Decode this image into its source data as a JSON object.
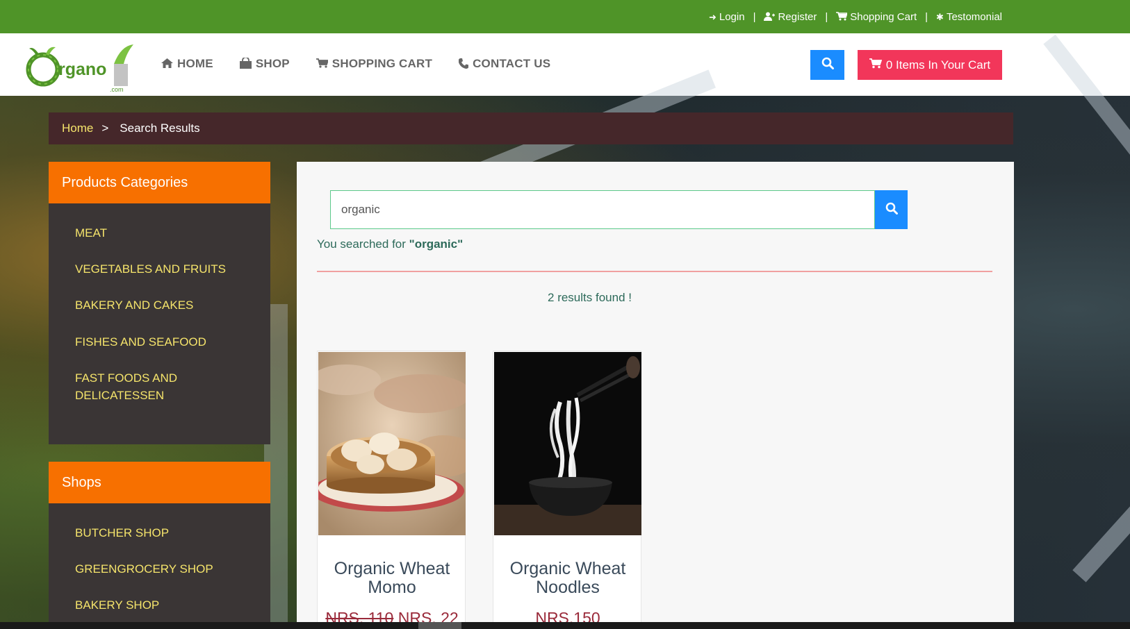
{
  "topbar": {
    "links": [
      {
        "label": "Login",
        "icon": "sign-in-icon"
      },
      {
        "label": "Register",
        "icon": "user-plus-icon"
      },
      {
        "label": "Shopping Cart",
        "icon": "cart-icon"
      },
      {
        "label": "Testomonial",
        "icon": "asterisk-icon"
      }
    ],
    "separator": "|"
  },
  "logo": {
    "text": "rgano",
    "sub": ".com"
  },
  "nav": {
    "items": [
      {
        "label": "HOME",
        "icon": "home-icon"
      },
      {
        "label": "SHOP",
        "icon": "shop-icon"
      },
      {
        "label": "SHOPPING CART",
        "icon": "cart-icon"
      },
      {
        "label": "CONTACT US",
        "icon": "phone-icon"
      }
    ],
    "cart_button": "0 Items In Your Cart"
  },
  "breadcrumb": {
    "home": "Home",
    "separator": ">",
    "current": "Search Results"
  },
  "sidebar": {
    "categories_title": "Products Categories",
    "categories": [
      "MEAT",
      "VEGETABLES AND FRUITS",
      "BAKERY AND CAKES",
      "FISHES AND SEAFOOD",
      "FAST FOODS AND DELICATESSEN"
    ],
    "shops_title": "Shops",
    "shops": [
      "BUTCHER SHOP",
      "GREENGROCERY SHOP",
      "BAKERY SHOP"
    ]
  },
  "search": {
    "value": "organic",
    "searched_prefix": "You searched for ",
    "searched_term": "\"organic\"",
    "results_text": "2 results found !"
  },
  "products": [
    {
      "name": "Organic Wheat Momo",
      "old_price": "NRS. 110",
      "price": "NRS. 22"
    },
    {
      "name": "Organic Wheat Noodles",
      "old_price": "",
      "price": "NRS.150"
    }
  ],
  "colors": {
    "topbar": "#4f9428",
    "accent": "#f77000",
    "cart": "#f2365a",
    "search": "#1a8cff",
    "link_yellow": "#f5e46b"
  }
}
